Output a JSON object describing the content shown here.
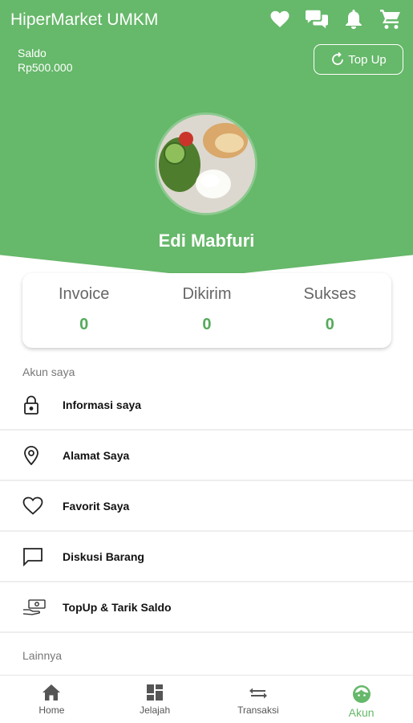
{
  "header": {
    "app_title": "HiperMarket UMKM",
    "icons": [
      "heart-icon",
      "chat-icon",
      "bell-icon",
      "cart-icon"
    ],
    "saldo_label": "Saldo",
    "saldo_value": "Rp500.000",
    "topup_label": "Top Up",
    "user_name": "Edi Mabfuri",
    "color": "#66b86a"
  },
  "stats": [
    {
      "label": "Invoice",
      "value": "0"
    },
    {
      "label": "Dikirim",
      "value": "0"
    },
    {
      "label": "Sukses",
      "value": "0"
    }
  ],
  "sections": {
    "akun_saya": "Akun saya",
    "lainnya": "Lainnya"
  },
  "menu": [
    {
      "label": "Informasi saya",
      "icon": "lock-icon"
    },
    {
      "label": "Alamat Saya",
      "icon": "location-pin-icon"
    },
    {
      "label": "Favorit Saya",
      "icon": "heart-outline-icon"
    },
    {
      "label": "Diskusi Barang",
      "icon": "chat-bubble-icon"
    },
    {
      "label": "TopUp & Tarik Saldo",
      "icon": "money-hand-icon"
    }
  ],
  "nav": [
    {
      "label": "Home",
      "icon": "home-icon"
    },
    {
      "label": "Jelajah",
      "icon": "grid-icon"
    },
    {
      "label": "Transaksi",
      "icon": "swap-icon"
    },
    {
      "label": "Akun",
      "icon": "face-icon",
      "active": true
    }
  ]
}
